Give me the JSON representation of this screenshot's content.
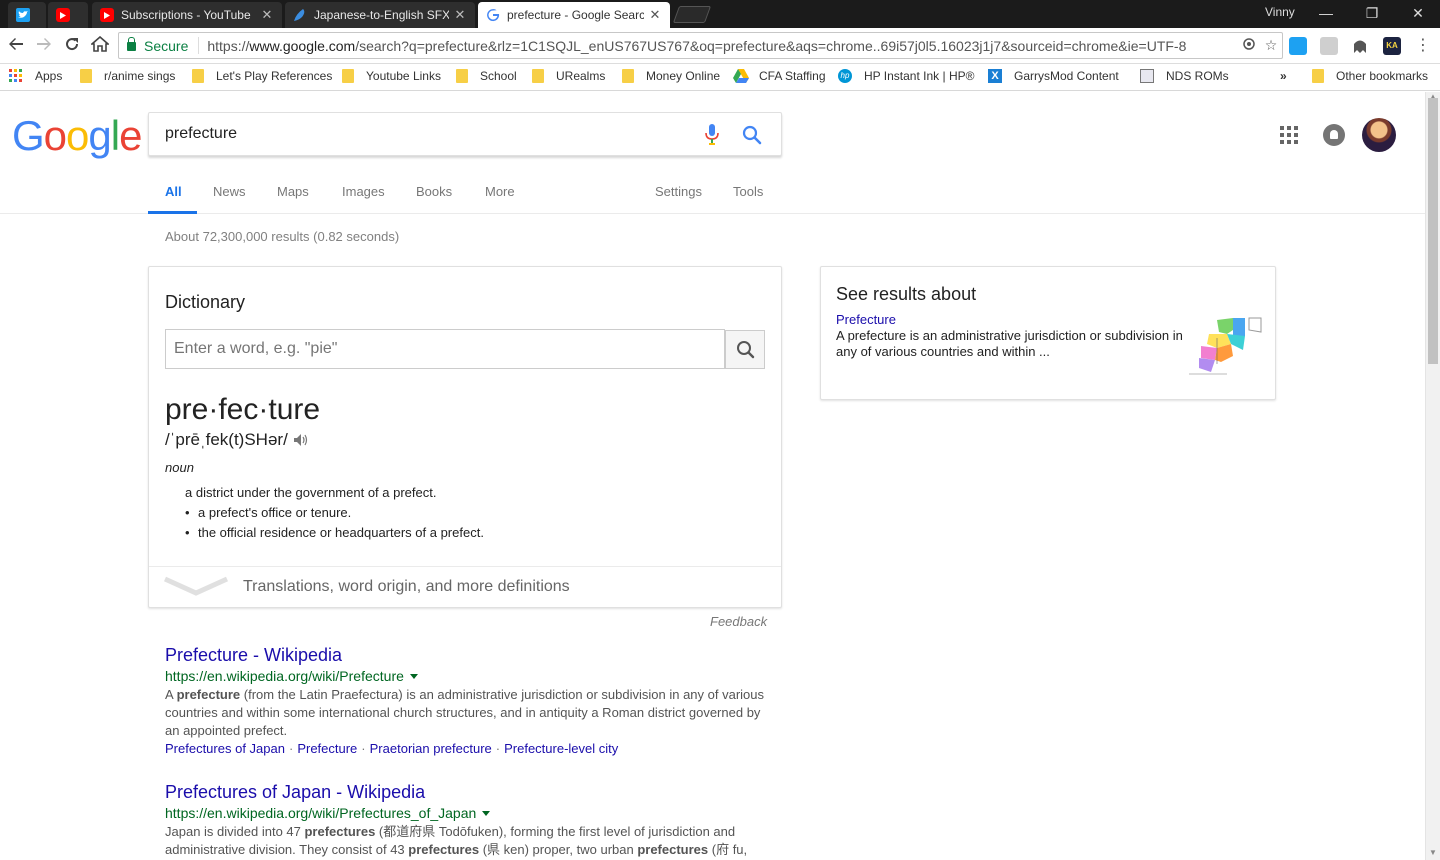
{
  "browser": {
    "tabs": [
      {
        "title": "",
        "favicon": "twitter-icon",
        "color": "#1da1f2"
      },
      {
        "title": "",
        "favicon": "youtube-icon",
        "color": "#ff0000"
      },
      {
        "title": "Subscriptions - YouTube",
        "favicon": "youtube-icon",
        "color": "#ff0000"
      },
      {
        "title": "Japanese-to-English SFX",
        "favicon": "feather-icon",
        "color": "#3b8de0"
      },
      {
        "title": "prefecture - Google Search",
        "favicon": "google-icon",
        "color": "#4285f4",
        "active": true
      }
    ],
    "profile_name": "Vinny",
    "secure_label": "Secure",
    "url_scheme": "https://",
    "url_host": "www.google.com",
    "url_rest": "/search?q=prefecture&rlz=1C1SQJL_enUS767US767&oq=prefecture&aqs=chrome..69i57j0l5.16023j1j7&sourceid=chrome&ie=UTF-8"
  },
  "bookmarks": [
    {
      "label": "Apps",
      "icon": "apps-grid-icon"
    },
    {
      "label": "r/anime sings",
      "icon": "folder-icon"
    },
    {
      "label": "Let's Play References",
      "icon": "folder-icon"
    },
    {
      "label": "Youtube Links",
      "icon": "folder-icon"
    },
    {
      "label": "School",
      "icon": "folder-icon"
    },
    {
      "label": "URealms",
      "icon": "folder-icon"
    },
    {
      "label": "Money Online",
      "icon": "folder-icon"
    },
    {
      "label": "CFA Staffing",
      "icon": "drive-icon"
    },
    {
      "label": "HP Instant Ink | HP®",
      "icon": "hp-icon"
    },
    {
      "label": "GarrysMod Content",
      "icon": "x-icon"
    },
    {
      "label": "NDS ROMs",
      "icon": "page-icon"
    },
    {
      "label": "»",
      "icon": ""
    },
    {
      "label": "Other bookmarks",
      "icon": "folder-icon"
    }
  ],
  "google": {
    "logo_letters": [
      {
        "ch": "G",
        "color": "#4285f4"
      },
      {
        "ch": "o",
        "color": "#ea4335"
      },
      {
        "ch": "o",
        "color": "#fbbc05"
      },
      {
        "ch": "g",
        "color": "#4285f4"
      },
      {
        "ch": "l",
        "color": "#34a853"
      },
      {
        "ch": "e",
        "color": "#ea4335"
      }
    ],
    "query": "prefecture",
    "tabs": [
      "All",
      "News",
      "Maps",
      "Images",
      "Books",
      "More",
      "Settings",
      "Tools"
    ],
    "active_tab": "All",
    "stats": "About 72,300,000 results (0.82 seconds)"
  },
  "dictionary": {
    "title": "Dictionary",
    "input_placeholder": "Enter a word, e.g. \"pie\"",
    "headword": "pre·fec·ture",
    "phonetic": "/ˈprēˌfek(t)SHər/",
    "part_of_speech": "noun",
    "definitions": [
      "a district under the government of a prefect.",
      "a prefect's office or tenure.",
      "the official residence or headquarters of a prefect."
    ],
    "more_label": "Translations, word origin, and more definitions",
    "feedback": "Feedback"
  },
  "results": [
    {
      "title": "Prefecture - Wikipedia",
      "url": "https://en.wikipedia.org/wiki/Prefecture",
      "snippet_html": "A <b>prefecture</b> (from the Latin Praefectura) is an administrative jurisdiction or subdivision in any of various countries and within some international church structures, and in antiquity a Roman district governed by an appointed prefect.",
      "sitelinks": [
        "Prefectures of Japan",
        "Prefecture",
        "Praetorian prefecture",
        "Prefecture-level city"
      ]
    },
    {
      "title": "Prefectures of Japan - Wikipedia",
      "url": "https://en.wikipedia.org/wiki/Prefectures_of_Japan",
      "snippet_html": "Japan is divided into 47 <b>prefectures</b> (都道府県 Todōfuken), forming the first level of jurisdiction and administrative division. They consist of 43 <b>prefectures</b> (県 ken) proper, two urban <b>prefectures</b> (府 fu,",
      "sitelinks": []
    }
  ],
  "knowledge_panel": {
    "title": "See results about",
    "link": "Prefecture",
    "description": "A prefecture is an administrative jurisdiction or subdivision in any of various countries and within ..."
  }
}
